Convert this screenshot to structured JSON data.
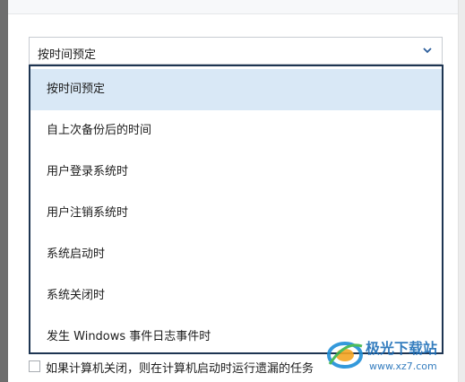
{
  "schedule": {
    "selected_value": "按时间预定",
    "options": [
      "按时间预定",
      "自上次备份后的时间",
      "用户登录系统时",
      "用户注销系统时",
      "系统启动时",
      "系统关闭时",
      "发生 Windows 事件日志事件时"
    ],
    "selected_index": 0
  },
  "checkbox": {
    "label": "如果计算机关闭，则在计算机启动时运行遗漏的任务",
    "checked": false
  },
  "watermark": {
    "brand": "极光下载站",
    "url": "www.xz7.com"
  },
  "colors": {
    "dropdown_border": "#1e3552",
    "selected_bg": "#d9e8f6",
    "chevron": "#2b5d9b"
  }
}
